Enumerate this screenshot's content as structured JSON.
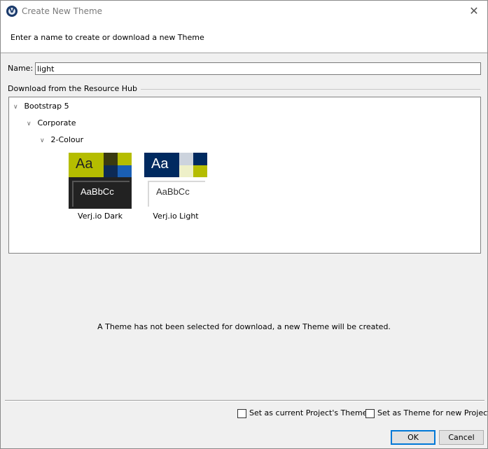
{
  "window": {
    "title": "Create New Theme",
    "header_text": "Enter a name to create or download a new Theme"
  },
  "name_field": {
    "label": "Name:",
    "value": "light"
  },
  "resource_hub": {
    "label": "Download from the Resource Hub",
    "tree": [
      {
        "label": "Bootstrap 5"
      },
      {
        "label": "Corporate"
      },
      {
        "label": "2-Colour"
      }
    ],
    "themes": [
      {
        "name": "Verj.io Dark",
        "sample_big": "Aa",
        "sample_small": "AaBbCc"
      },
      {
        "name": "Verj.io Light",
        "sample_big": "Aa",
        "sample_small": "AaBbCc"
      }
    ]
  },
  "status_text": "A Theme has not been selected for download, a new Theme will be created.",
  "options": {
    "current_project": "Set as current Project's Theme",
    "new_projects": "Set as Theme for new Projects"
  },
  "buttons": {
    "ok": "OK",
    "cancel": "Cancel"
  },
  "colors": {
    "dark_primary": "#b5bd00",
    "dark_bg": "#222222",
    "dark_accent": "#003a80",
    "light_primary": "#002a60",
    "light_accent": "#b5bd00"
  }
}
